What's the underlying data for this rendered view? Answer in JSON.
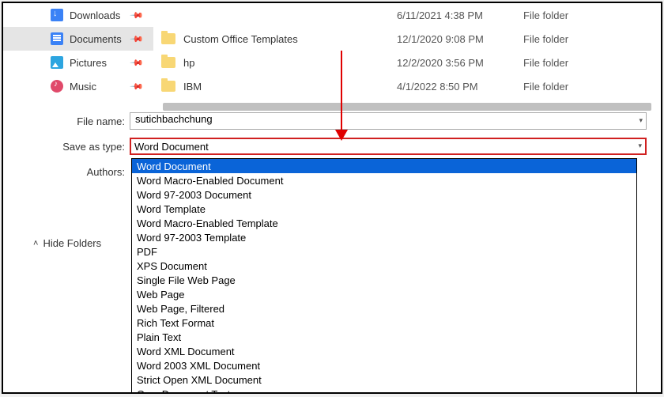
{
  "sidebar": {
    "items": [
      {
        "label": "Downloads",
        "pinned": true,
        "icon": "download-icon",
        "selected": false
      },
      {
        "label": "Documents",
        "pinned": true,
        "icon": "document-icon",
        "selected": true
      },
      {
        "label": "Pictures",
        "pinned": true,
        "icon": "pictures-icon",
        "selected": false
      },
      {
        "label": "Music",
        "pinned": true,
        "icon": "music-icon",
        "selected": false
      }
    ]
  },
  "file_list": {
    "rows": [
      {
        "name": "",
        "date": "6/11/2021 4:38 PM",
        "type": "File folder"
      },
      {
        "name": "Custom Office Templates",
        "date": "12/1/2020 9:08 PM",
        "type": "File folder"
      },
      {
        "name": "hp",
        "date": "12/2/2020 3:56 PM",
        "type": "File folder"
      },
      {
        "name": "IBM",
        "date": "4/1/2022 8:50 PM",
        "type": "File folder"
      }
    ]
  },
  "form": {
    "filename_label": "File name:",
    "filename_value": "sutichbachchung",
    "saveastype_label": "Save as type:",
    "saveastype_value": "Word Document",
    "authors_label": "Authors:"
  },
  "dropdown": {
    "options": [
      "Word Document",
      "Word Macro-Enabled Document",
      "Word 97-2003 Document",
      "Word Template",
      "Word Macro-Enabled Template",
      "Word 97-2003 Template",
      "PDF",
      "XPS Document",
      "Single File Web Page",
      "Web Page",
      "Web Page, Filtered",
      "Rich Text Format",
      "Plain Text",
      "Word XML Document",
      "Word 2003 XML Document",
      "Strict Open XML Document",
      "OpenDocument Text"
    ],
    "selected_index": 0
  },
  "hide_folders_label": "Hide Folders",
  "annotation": {
    "arrow_color": "#e00000"
  }
}
